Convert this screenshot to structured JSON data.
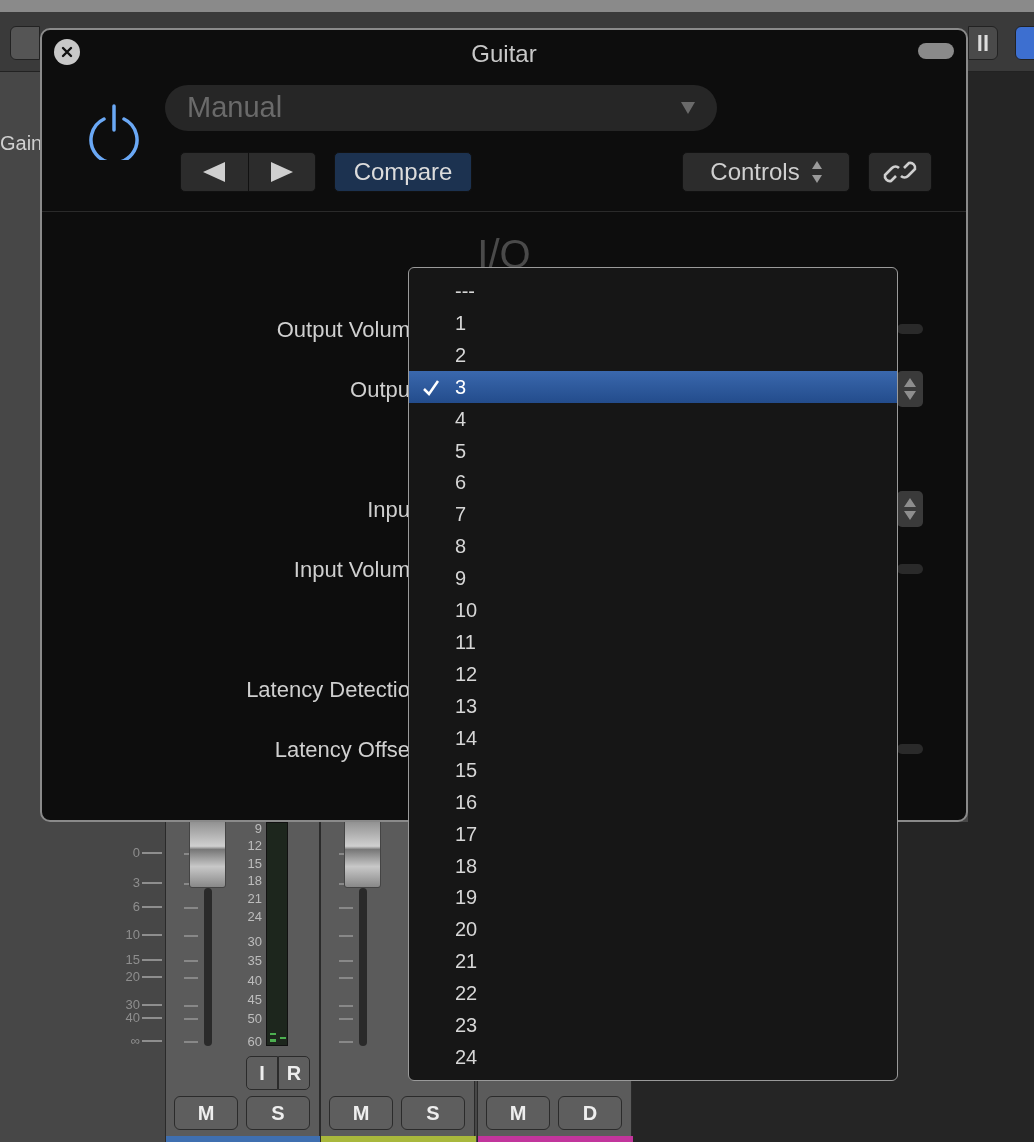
{
  "toolbar": {
    "partial_label": "ll"
  },
  "mixer": {
    "side_label": "Gain",
    "fader_scale": [
      "0",
      "3",
      "6",
      "10",
      "15",
      "20",
      "30",
      "40",
      "∞"
    ],
    "strips": [
      {
        "color": "#3f6fb0",
        "meter_scale": [
          "9",
          "12",
          "15",
          "18",
          "21",
          "24",
          "30",
          "35",
          "40",
          "45",
          "50",
          "60"
        ],
        "input_buttons": [
          "I",
          "R"
        ],
        "buttons": [
          "M",
          "S"
        ]
      },
      {
        "color": "#a9b83c",
        "buttons": [
          "M",
          "S"
        ]
      },
      {
        "color": "#c2359c",
        "buttons": [
          "M",
          "D"
        ]
      }
    ]
  },
  "plugin_window": {
    "title": "Guitar",
    "preset": "Manual",
    "compare": {
      "label": "Compare",
      "selected": true
    },
    "view_menu": "Controls",
    "section_title": "I/O",
    "groups": [
      {
        "rows": [
          {
            "label": "Output Volum",
            "kind": "slider"
          },
          {
            "label": "Outpu",
            "kind": "stepper"
          }
        ]
      },
      {
        "rows": [
          {
            "label": "Inpu",
            "kind": "stepper"
          },
          {
            "label": "Input Volum",
            "kind": "slider"
          }
        ]
      },
      {
        "rows": [
          {
            "label": "Latency Detectio",
            "kind": "none"
          },
          {
            "label": "Latency Offse",
            "kind": "slider"
          }
        ]
      }
    ]
  },
  "popup_menu": {
    "items": [
      {
        "label": "---",
        "selected": false
      },
      {
        "label": "1",
        "selected": false
      },
      {
        "label": "2",
        "selected": false
      },
      {
        "label": "3",
        "selected": true
      },
      {
        "label": "4",
        "selected": false
      },
      {
        "label": "5",
        "selected": false
      },
      {
        "label": "6",
        "selected": false
      },
      {
        "label": "7",
        "selected": false
      },
      {
        "label": "8",
        "selected": false
      },
      {
        "label": "9",
        "selected": false
      },
      {
        "label": "10",
        "selected": false
      },
      {
        "label": "11",
        "selected": false
      },
      {
        "label": "12",
        "selected": false
      },
      {
        "label": "13",
        "selected": false
      },
      {
        "label": "14",
        "selected": false
      },
      {
        "label": "15",
        "selected": false
      },
      {
        "label": "16",
        "selected": false
      },
      {
        "label": "17",
        "selected": false
      },
      {
        "label": "18",
        "selected": false
      },
      {
        "label": "19",
        "selected": false
      },
      {
        "label": "20",
        "selected": false
      },
      {
        "label": "21",
        "selected": false
      },
      {
        "label": "22",
        "selected": false
      },
      {
        "label": "23",
        "selected": false
      },
      {
        "label": "24",
        "selected": false
      }
    ]
  }
}
